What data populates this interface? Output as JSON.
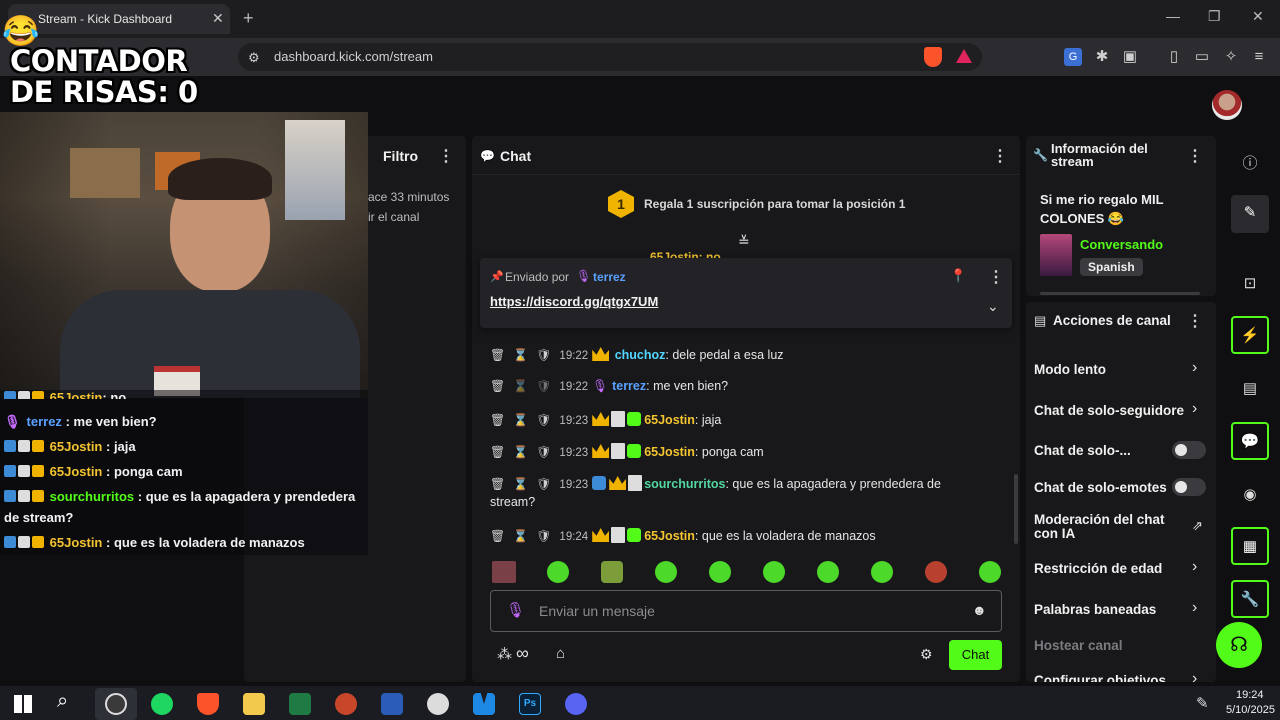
{
  "browser": {
    "tab_title": "Stream - Kick Dashboard",
    "tab_close": "✕",
    "new_tab": "+",
    "url": "dashboard.kick.com/stream",
    "window_controls": [
      "—",
      "❐",
      "✕"
    ]
  },
  "overlay": {
    "counter_line1": "CONTADOR",
    "counter_line2": "DE RISAS: 0",
    "laugh_emoji": "😂"
  },
  "left_panel": {
    "title": "Filtro",
    "line1": "ace 33 minutos",
    "line2": "ir el canal"
  },
  "overlay_chat": [
    {
      "user": "65Jostin",
      "text": ": no",
      "user_color": "#f4c430"
    },
    {
      "user": "terrez",
      "text": ": me ven bien?",
      "user_color": "#5aa0ff"
    },
    {
      "user": "65Jostin",
      "text": ": jaja",
      "user_color": "#f4c430"
    },
    {
      "user": "65Jostin",
      "text": ": ponga cam",
      "user_color": "#f4c430"
    },
    {
      "user": "sourchurritos",
      "text": ": que es la apagadera y prendedera",
      "text2": "de stream?",
      "user_color": "#53fc18"
    },
    {
      "user": "65Jostin",
      "text": ": que es la voladera de manazos",
      "user_color": "#f4c430"
    }
  ],
  "chat": {
    "title": "Chat",
    "gift_rank": "1",
    "gift_text": "Regala 1 suscripción para tomar la posición 1",
    "partial_line": "65Jostin: no",
    "pinned": {
      "sent_by_label": "Enviado por",
      "sent_by_user": "terrez",
      "link": "https://discord.gg/qtgx7UM"
    },
    "messages": [
      {
        "time": "19:22",
        "user": "chuchoz",
        "text": ": dele pedal a esa luz",
        "user_color": "#53d6ff"
      },
      {
        "time": "19:22",
        "user": "terrez",
        "text": ": me ven bien?",
        "user_color": "#5aa0ff"
      },
      {
        "time": "19:23",
        "user": "65Jostin",
        "text": ": jaja",
        "user_color": "#f4c430"
      },
      {
        "time": "19:23",
        "user": "65Jostin",
        "text": ": ponga cam",
        "user_color": "#f4c430"
      },
      {
        "time": "19:23",
        "user": "sourchurritos",
        "text": ": que es la apagadera y prendedera de",
        "text2": "stream?",
        "user_color": "#53fc18"
      },
      {
        "time": "19:24",
        "user": "65Jostin",
        "text": ": que es la voladera de manazos",
        "user_color": "#f4c430"
      }
    ],
    "input_placeholder": "Enviar un mensaje",
    "infinity": "∞",
    "send_label": "Chat"
  },
  "stream_info": {
    "title": "Información del stream",
    "stream_title": "Si me rio regalo MIL COLONES 😂",
    "category": "Conversando",
    "tag": "Spanish"
  },
  "channel_actions": {
    "title": "Acciones de canal",
    "items": [
      {
        "label": "Modo lento"
      },
      {
        "label": "Chat de solo-seguidore"
      },
      {
        "label": "Chat de solo-..."
      },
      {
        "label": "Chat de solo-emotes"
      },
      {
        "label": "Moderación del chat",
        "label2": "con IA"
      },
      {
        "label": "Restricción de edad"
      },
      {
        "label": "Palabras baneadas"
      },
      {
        "label": "Hostear canal"
      },
      {
        "label": "Configurar objetivos"
      }
    ]
  },
  "taskbar": {
    "time": "19:24",
    "date": "5/10/2025"
  },
  "colors": {
    "accent": "#53fc18",
    "gold": "#f0b300"
  }
}
